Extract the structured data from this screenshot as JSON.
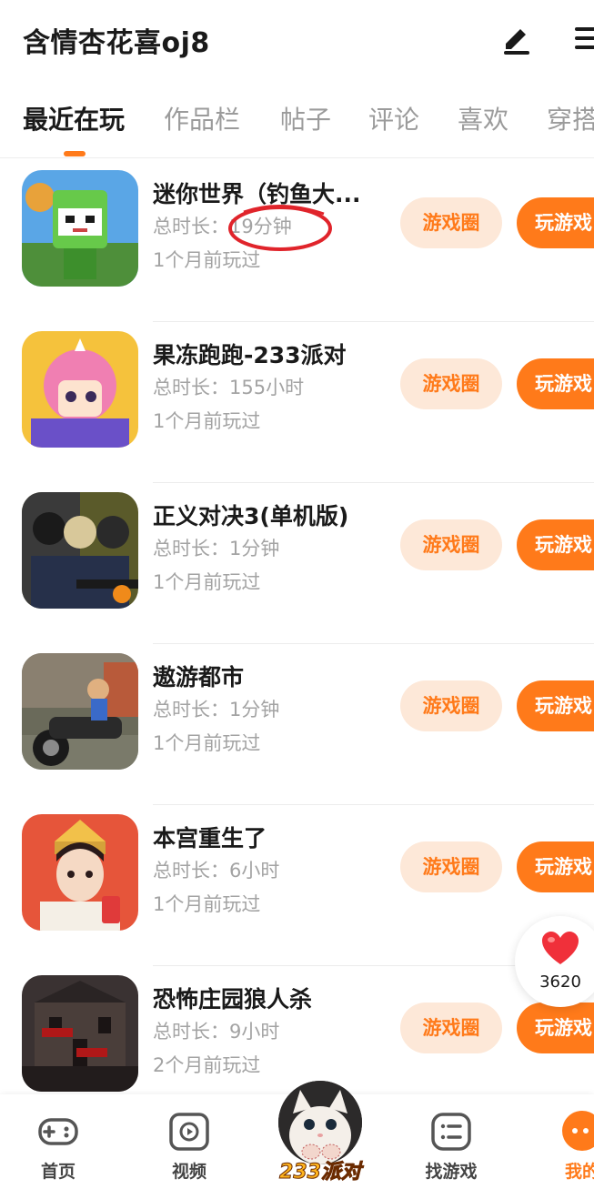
{
  "header": {
    "profile_name": "含情杏花喜oj8",
    "edit_icon": "edit-pen-icon",
    "menu_icon": "menu-icon"
  },
  "tabs": [
    {
      "label": "最近在玩",
      "active": true
    },
    {
      "label": "作品栏",
      "active": false
    },
    {
      "label": "帖子",
      "active": false
    },
    {
      "label": "评论",
      "active": false
    },
    {
      "label": "喜欢",
      "active": false
    },
    {
      "label": "穿搭",
      "active": false
    }
  ],
  "games": [
    {
      "title": "迷你世界（钓鱼大...",
      "duration_label": "总时长：",
      "duration": "19分钟",
      "last_played": "1个月前玩过",
      "circle_label": "游戏圈",
      "play_label": "玩游戏"
    },
    {
      "title": "果冻跑跑-233派对",
      "duration_label": "总时长：",
      "duration": "155小时",
      "last_played": "1个月前玩过",
      "circle_label": "游戏圈",
      "play_label": "玩游戏"
    },
    {
      "title": "正义对决3(单机版)",
      "duration_label": "总时长：",
      "duration": "1分钟",
      "last_played": "1个月前玩过",
      "circle_label": "游戏圈",
      "play_label": "玩游戏"
    },
    {
      "title": "遨游都市",
      "duration_label": "总时长：",
      "duration": "1分钟",
      "last_played": "1个月前玩过",
      "circle_label": "游戏圈",
      "play_label": "玩游戏"
    },
    {
      "title": "本宫重生了",
      "duration_label": "总时长：",
      "duration": "6小时",
      "last_played": "1个月前玩过",
      "circle_label": "游戏圈",
      "play_label": "玩游戏"
    },
    {
      "title": "恐怖庄园狼人杀",
      "duration_label": "总时长：",
      "duration": "9小时",
      "last_played": "2个月前玩过",
      "circle_label": "游戏圈",
      "play_label": "玩游戏"
    }
  ],
  "like": {
    "count": "3620",
    "icon": "heart-icon"
  },
  "nav": {
    "home": "首页",
    "video": "视频",
    "party": "233派对",
    "find_game": "找游戏",
    "mine": "我的"
  },
  "colors": {
    "accent": "#ff7a1a",
    "accent_light": "#fde8d8",
    "annotation": "#e0242b"
  }
}
